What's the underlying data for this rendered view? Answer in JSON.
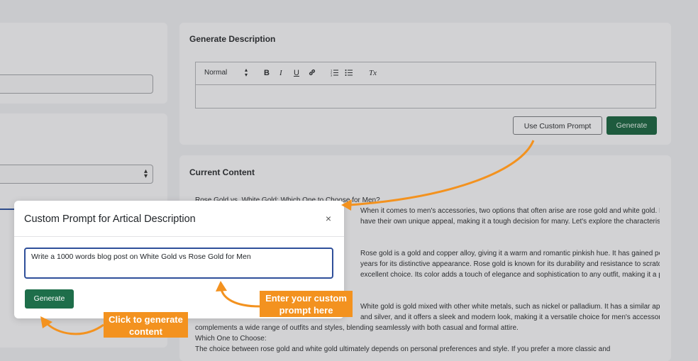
{
  "generate_description": {
    "title": "Generate Description",
    "toolbar": {
      "format_select": "Normal",
      "bold": "B",
      "italic": "I",
      "underline": "U",
      "clear_format": "Tx"
    },
    "use_custom_prompt_label": "Use Custom Prompt",
    "generate_label": "Generate"
  },
  "current_content": {
    "title": "Current Content",
    "lines": [
      "Rose Gold vs. White Gold: Which One to Choose for Men?",
      "When it comes to men's accessories, two options that often arise are rose gold and white gold. Both",
      "have their own unique appeal, making it a tough decision for many. Let's explore the characteristics of each to help",
      "",
      "",
      "Rose gold is a gold and copper alloy, giving it a warm and romantic pinkish hue. It has gained popularity in recent",
      "years for its distinctive appearance. Rose gold is known for its durability and resistance to scratches, making it an",
      "excellent choice. Its color adds a touch of elegance and sophistication to any outfit, making it a popular choice",
      "",
      "",
      "White gold is gold mixed with other white metals, such as nickel or palladium. It has a similar appearance to platinum",
      "and silver, and it offers a sleek and modern look, making it a versatile choice for men's accessories. It",
      "complements a wide range of outfits and styles, blending seamlessly with both casual and formal attire.",
      "Which One to Choose:",
      "The choice between rose gold and white gold ultimately depends on personal preferences and style. If you prefer a more classic and"
    ]
  },
  "modal": {
    "title": "Custom Prompt for Artical Description",
    "close": "×",
    "prompt_value": "Write a 1000 words blog post on White Gold vs Rose Gold for Men",
    "generate_label": "Generate"
  },
  "callouts": {
    "prompt_hint": "Enter your custom prompt here",
    "generate_hint": "Click to generate content"
  },
  "colors": {
    "accent_green": "#1e6e4a",
    "callout_orange": "#f3921f",
    "focus_blue": "#2f4f9a"
  }
}
